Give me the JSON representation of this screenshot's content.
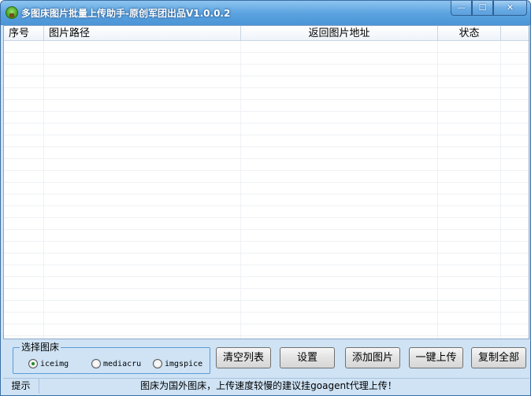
{
  "window": {
    "title": "多图床图片批量上传助手-原创军团出品V1.0.0.2",
    "minimize_glyph": "—",
    "maximize_glyph": "☐",
    "close_glyph": "✕"
  },
  "table": {
    "columns": [
      "序号",
      "图片路径",
      "返回图片地址",
      "状态"
    ],
    "rows": []
  },
  "host_group": {
    "title": "选择图床",
    "options": [
      {
        "label": "iceimg",
        "checked": true
      },
      {
        "label": "mediacru",
        "checked": false
      },
      {
        "label": "imgspice",
        "checked": false
      }
    ]
  },
  "buttons": {
    "clear": "清空列表",
    "settings": "设置",
    "add": "添加图片",
    "upload": "一键上传",
    "copy_all": "复制全部"
  },
  "status": {
    "label": "提示",
    "message": "图床为国外图床，上传速度较慢的建议挂goagent代理上传！"
  }
}
